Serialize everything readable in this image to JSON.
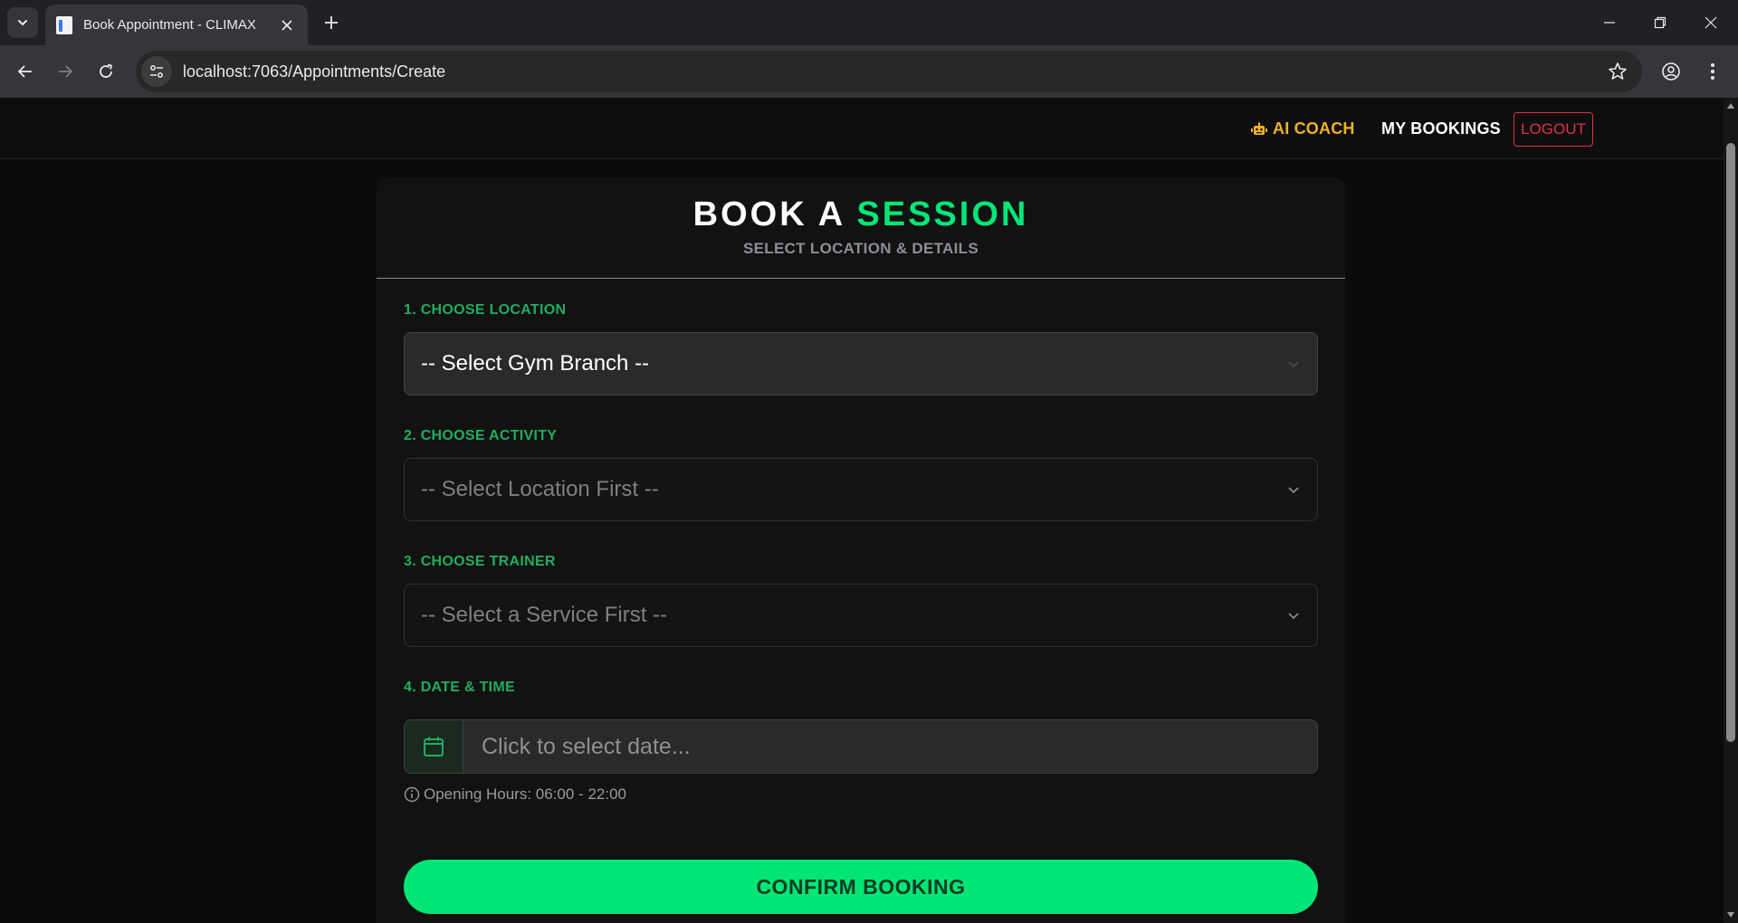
{
  "browser": {
    "tab_title": "Book Appointment - CLIMAX",
    "url_host": "localhost",
    "url_path": ":7063/Appointments/Create"
  },
  "nav": {
    "ai_coach": "AI COACH",
    "my_bookings": "MY BOOKINGS",
    "logout": "LOGOUT"
  },
  "card": {
    "title_main": "BOOK A",
    "title_accent": "SESSION",
    "subtitle": "SELECT LOCATION & DETAILS"
  },
  "form": {
    "location": {
      "label": "1. CHOOSE LOCATION",
      "value": "-- Select Gym Branch --"
    },
    "activity": {
      "label": "2. CHOOSE ACTIVITY",
      "value": "-- Select Location First --"
    },
    "trainer": {
      "label": "3. CHOOSE TRAINER",
      "value": "-- Select a Service First --"
    },
    "datetime": {
      "label": "4. DATE & TIME",
      "placeholder": "Click to select date..."
    },
    "hours_note": "Opening Hours: 06:00 - 22:00",
    "submit": "CONFIRM BOOKING"
  },
  "colors": {
    "accent_green": "#00e676",
    "label_green": "#1fae5f",
    "ai_coach_gold": "#f0b323",
    "logout_red": "#dc3545"
  }
}
